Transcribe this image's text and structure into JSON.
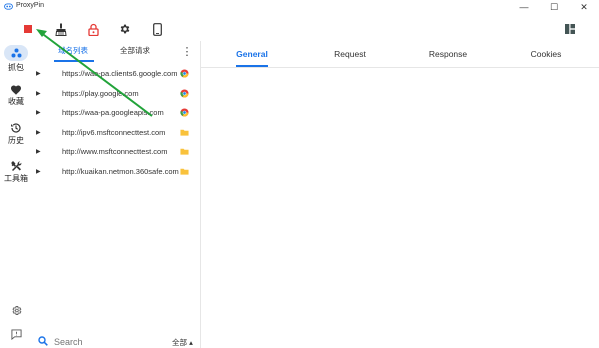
{
  "app": {
    "title": "ProxyPin"
  },
  "window_controls": {
    "minimize": "—",
    "maximize": "☐",
    "close": "✕"
  },
  "toolbar": {
    "buttons": [
      {
        "name": "stop-capture",
        "icon": "stop-icon"
      },
      {
        "name": "clean",
        "icon": "broom-icon"
      },
      {
        "name": "ssl-lock",
        "icon": "lock-icon"
      },
      {
        "name": "settings",
        "icon": "gear-icon"
      },
      {
        "name": "mobile",
        "icon": "phone-icon"
      }
    ]
  },
  "nav": {
    "items": [
      {
        "label": "抓包",
        "icon": "capture-icon",
        "active": true
      },
      {
        "label": "收藏",
        "icon": "heart-icon"
      },
      {
        "label": "历史",
        "icon": "history-icon"
      },
      {
        "label": "工具箱",
        "icon": "tools-icon"
      }
    ]
  },
  "list": {
    "tabs": [
      {
        "label": "域名列表",
        "active": true
      },
      {
        "label": "全部请求",
        "active": false
      }
    ],
    "more": "⋮",
    "rows": [
      {
        "url": "https://waa-pa.clients6.google.com",
        "icon": "chrome-icon"
      },
      {
        "url": "https://play.google.com",
        "icon": "chrome-icon"
      },
      {
        "url": "https://waa-pa.googleapis.com",
        "icon": "chrome-icon"
      },
      {
        "url": "http://ipv6.msftconnecttest.com",
        "icon": "folder-icon"
      },
      {
        "url": "http://www.msftconnecttest.com",
        "icon": "folder-icon"
      },
      {
        "url": "http://kuaikan.netmon.360safe.com",
        "icon": "folder-icon"
      }
    ],
    "search": {
      "placeholder": "Search",
      "filter_label": "全部 ▴"
    }
  },
  "detail": {
    "tabs": [
      {
        "label": "General",
        "active": true
      },
      {
        "label": "Request",
        "active": false
      },
      {
        "label": "Response",
        "active": false
      },
      {
        "label": "Cookies",
        "active": false
      }
    ]
  },
  "colors": {
    "accent": "#1a73e8",
    "stop": "#e53935",
    "arrow": "#22a33a",
    "nav_active": "#d9e6f7"
  }
}
